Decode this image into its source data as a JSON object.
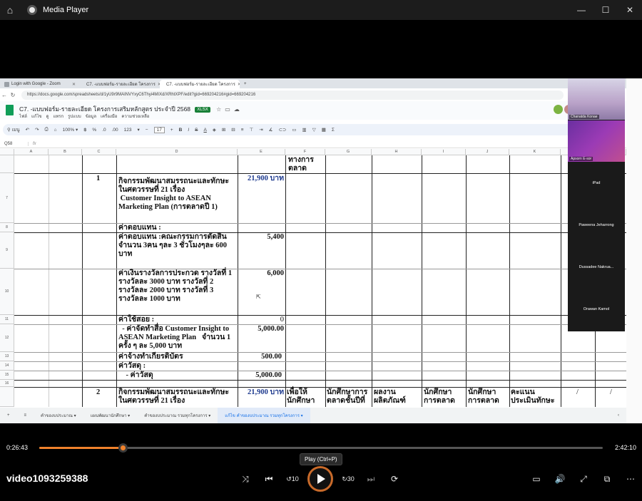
{
  "player": {
    "title": "Media Player",
    "current_time": "0:26:43",
    "total_time": "2:42:10",
    "progress": 0.148,
    "tooltip": "Play (Ctrl+P)",
    "video_name": "video1093259388"
  },
  "browser": {
    "tabs": [
      {
        "label": "Login with Google - Zoom",
        "active": false
      },
      {
        "label": "C7. -แบบฟอร์ม-รายละเอียด โครงการ",
        "active": false
      },
      {
        "label": "C7. -แบบฟอร์ม-รายละเอียด โครงการ",
        "active": true
      }
    ],
    "url": "https://docs.google.com/spreadsheets/d/1yU9r9MAINVYxyC6Thyi4MIXd/XRhtXPF/edit?gid=669204216#gid=669204216"
  },
  "sheet": {
    "title": "C7. -แบบฟอร์ม-รายละเอียด โครงการเสริมหลักสูตร ประจำปี 2568",
    "badge": "XLSX",
    "menus": [
      "ไฟล์",
      "แก้ไข",
      "ดู",
      "แทรก",
      "รูปแบบ",
      "ข้อมูล",
      "เครื่องมือ",
      "ความช่วยเหลือ"
    ],
    "toolbar": {
      "search": "เมนู",
      "zoom": "100%",
      "currency": "฿",
      "percent": "%",
      "decimal_dec": ".0",
      "decimal_inc": ".00",
      "format_num": "123",
      "font_size": "17"
    },
    "cell_ref": "Q58",
    "fx": "fx",
    "columns": [
      "A",
      "B",
      "C",
      "D",
      "E",
      "F",
      "G",
      "H",
      "I",
      "J",
      "K"
    ],
    "rows": [
      "",
      "7",
      "8",
      "9",
      "10",
      "11",
      "12",
      "13",
      "14",
      "15",
      "16",
      ""
    ],
    "cells": {
      "f_top": "ทางการ\nตลาด",
      "c7": "1",
      "d7": "กิจกรรมพัฒนาสมรรถนะและทักษะ\nในศตวรรษที่ 21 เรื่อง\n Customer Insight to ASEAN\nMarketing Plan (การตลาดปี 1)",
      "e7": "21,900 บาท",
      "d8": "ค่าตอบแทน :",
      "d9": "ค่าตอบแทน :คณะกรรมการตัดสิน\nจำนวน 3คน ๆละ 3 ชั่วโมงๆละ 600\nบาท",
      "e9": "5,400",
      "d10": "ค่าเงินรางวัลการประกวด รางวัลที่ 1\nรางวัลละ 3000 บาท รางวัลที่ 2\nรางวัลละ 2000 บาท รางวัลที่ 3\nรางวัลละ 1000 บาท",
      "e10": "6,000",
      "d11": "ค่าใช้สอย :",
      "e11": "0",
      "d12": "  - ค่าจัดทำสื่อ Customer Insight to\nASEAN Marketing Plan   จำนวน 1\nครั้ง ๆ ละ 5,000 บาท",
      "e12": "5,000.00",
      "d13": "ค่าจ้างทำเกียรติบัตร",
      "e13": "500.00",
      "d14": "ค่าวัสดุ :",
      "d15": "    - ค่าวัสดุ",
      "e15": "5,000.00",
      "c_last": "2",
      "d_last": "กิจกรรมพัฒนาสมรรถนะและทักษะ\nในศตวรรษที่ 21 เรื่อง",
      "e_last": "21,900 บาท",
      "f_last": "เพื่อให้\nนักศึกษา",
      "g_last": "นักศึกษาการ\nตลาดชั้นปีที่",
      "h_last": "ผลงาน\nผลิตภัณฑ์",
      "i_last": "นักศึกษา\nการตลาด",
      "j_last": "นักศึกษา\nการตลาด",
      "k_last": "คะแนน\nประเมินทักษะ",
      "l_last": "/",
      "m_last": "/"
    },
    "sheet_tabs": [
      {
        "label": "คำของบประมาณ ▾",
        "active": false
      },
      {
        "label": "แผนพัฒนานักศึกษา ▾",
        "active": false
      },
      {
        "label": "คำของบประมาณ รวมทุกโครงการ ▾",
        "active": false
      },
      {
        "label": "แก้ไข คำของบประมาณ รวมทุกโครงการ ▾",
        "active": true
      }
    ]
  },
  "participants": [
    {
      "name": "Chanatda Konae",
      "video": true
    },
    {
      "name": "Apsorn E-sor",
      "video": true
    },
    {
      "name": "iPad",
      "video": false
    },
    {
      "name": "Paweena Jeharrong",
      "video": false
    },
    {
      "name": "Dussadee  Nakrua...",
      "video": false
    },
    {
      "name": "Orawan Kamol",
      "video": false
    }
  ]
}
